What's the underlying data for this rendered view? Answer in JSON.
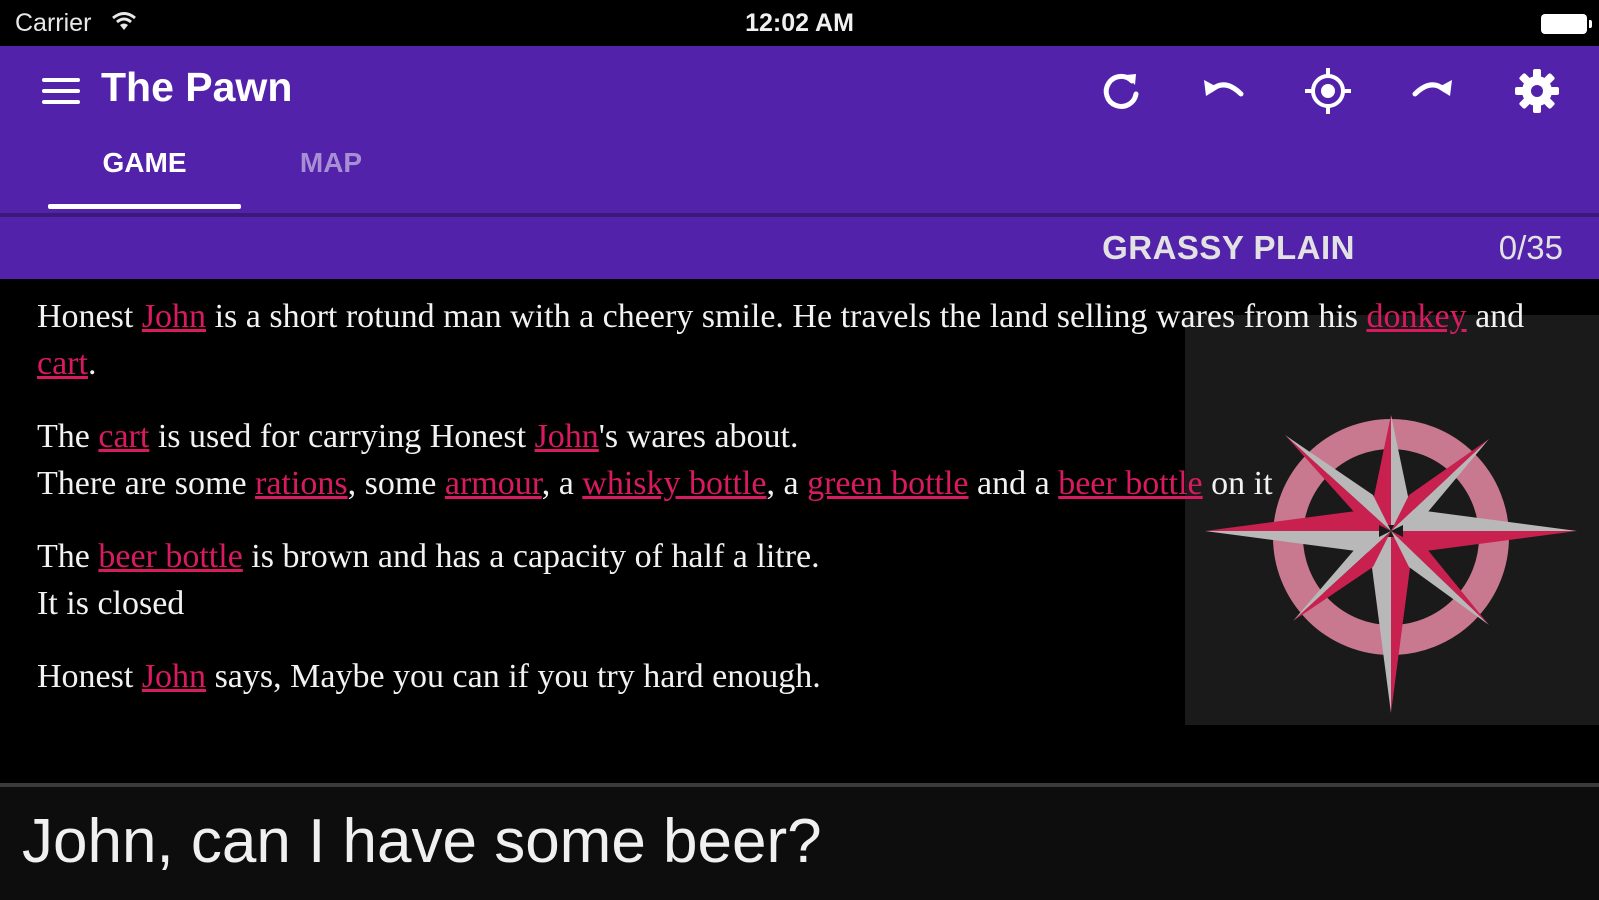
{
  "status_bar": {
    "carrier": "Carrier",
    "time": "12:02 AM",
    "wifi_icon": "wifi-icon",
    "battery_icon": "battery-icon"
  },
  "app_bar": {
    "title": "The Pawn",
    "menu_icon": "hamburger-menu-icon",
    "actions": [
      {
        "name": "refresh",
        "icon": "refresh-icon"
      },
      {
        "name": "undo",
        "icon": "undo-icon"
      },
      {
        "name": "locate",
        "icon": "crosshair-icon"
      },
      {
        "name": "redo",
        "icon": "redo-icon"
      },
      {
        "name": "settings",
        "icon": "gear-icon"
      }
    ],
    "tabs": [
      {
        "label": "GAME",
        "active": true
      },
      {
        "label": "MAP",
        "active": false
      }
    ],
    "color": "#5322ab"
  },
  "location_bar": {
    "location": "GRASSY PLAIN",
    "score": "0/35"
  },
  "story": {
    "link_color": "#d81b60",
    "p1": {
      "t1": "Honest ",
      "l1": "John",
      "t2": " is a short rotund man with a cheery smile. He travels the land selling wares from his ",
      "l2": "donkey",
      "t3": " and ",
      "l3": "cart",
      "t4": "."
    },
    "p2": {
      "t1": "The ",
      "l1": "cart",
      "t2": " is used for carrying Honest ",
      "l2": "John",
      "t3": "'s wares about.",
      "t4": "There are some ",
      "l3": "rations",
      "t5": ", some ",
      "l4": "armour",
      "t6": ", a ",
      "l5": "whisky bottle",
      "t7": ", a ",
      "l6": "green bottle",
      "t8": " and a ",
      "l7": "beer bottle",
      "t9": " on it"
    },
    "p3": {
      "t1": "The ",
      "l1": "beer bottle",
      "t2": " is brown and has a capacity of half a litre.",
      "t3": "It is closed"
    },
    "p4": {
      "t1": "Honest ",
      "l1": "John",
      "t2": " says, Maybe you can if you try hard enough."
    }
  },
  "compass": {
    "icon": "compass-rose-icon",
    "ring_color": "#c9798f",
    "point_color": "#c8204f",
    "light_color": "#b8b8b8"
  },
  "command_input": {
    "value": "John, can I have some beer?"
  }
}
